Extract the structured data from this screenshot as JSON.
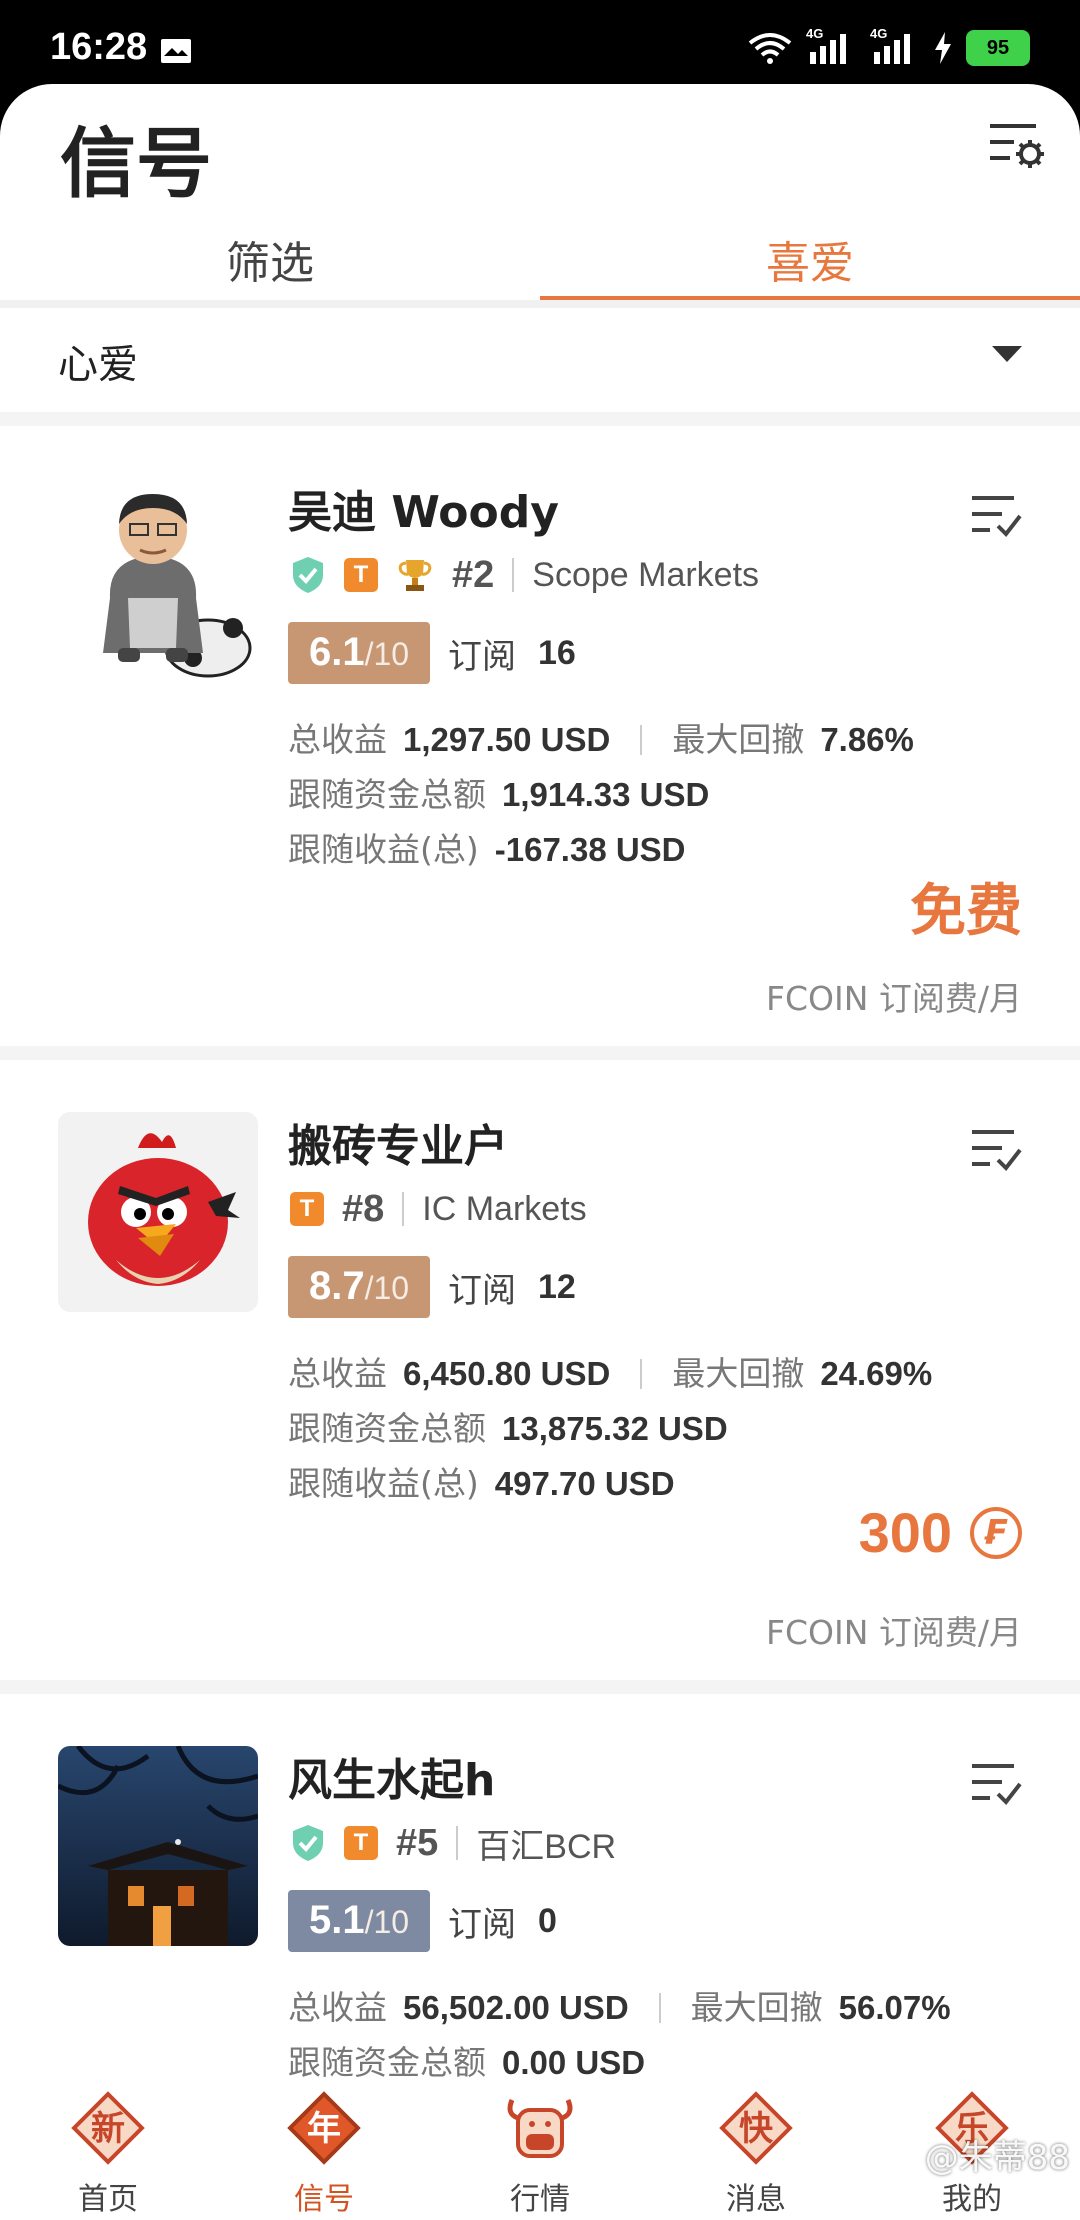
{
  "status_bar": {
    "time": "16:28",
    "battery": "95",
    "network_1": "4G",
    "network_2": "4G"
  },
  "header": {
    "title": "信号",
    "settings_icon": "filter-settings-icon"
  },
  "tabs": [
    {
      "label": "筛选",
      "active": false
    },
    {
      "label": "喜爱",
      "active": true
    }
  ],
  "dropdown": {
    "selected": "心爱"
  },
  "cards": [
    {
      "name": "吴迪 Woody",
      "verified": true,
      "t_badge": "T",
      "trophy": true,
      "rank": "#2",
      "broker": "Scope Markets",
      "score": "6.1",
      "score_den": "/10",
      "score_color": "#c79774",
      "sub_label": "订阅",
      "sub_count": "16",
      "total_profit_label": "总收益",
      "total_profit": "1,297.50 USD",
      "max_dd_label": "最大回撤",
      "max_dd": "7.86%",
      "follow_funds_label": "跟随资金总额",
      "follow_funds": "1,914.33 USD",
      "follow_profit_label": "跟随收益(总)",
      "follow_profit": "-167.38 USD",
      "price": "免费",
      "price_unit": "FCOIN 订阅费/月"
    },
    {
      "name": "搬砖专业户",
      "verified": false,
      "t_badge": "T",
      "trophy": false,
      "rank": "#8",
      "broker": "IC Markets",
      "score": "8.7",
      "score_den": "/10",
      "score_color": "#c79774",
      "sub_label": "订阅",
      "sub_count": "12",
      "total_profit_label": "总收益",
      "total_profit": "6,450.80 USD",
      "max_dd_label": "最大回撤",
      "max_dd": "24.69%",
      "follow_funds_label": "跟随资金总额",
      "follow_funds": "13,875.32 USD",
      "follow_profit_label": "跟随收益(总)",
      "follow_profit": "497.70 USD",
      "price": "300",
      "coin_symbol": "₣",
      "price_unit": "FCOIN 订阅费/月"
    },
    {
      "name": "风生水起h",
      "verified": true,
      "t_badge": "T",
      "trophy": false,
      "rank": "#5",
      "broker": "百汇BCR",
      "score": "5.1",
      "score_den": "/10",
      "score_color": "#7d8aa2",
      "sub_label": "订阅",
      "sub_count": "0",
      "total_profit_label": "总收益",
      "total_profit": "56,502.00 USD",
      "max_dd_label": "最大回撤",
      "max_dd": "56.07%",
      "follow_funds_label": "跟随资金总额",
      "follow_funds": "0.00 USD"
    }
  ],
  "bottom_nav": [
    {
      "label": "首页",
      "glyph": "新",
      "active": false
    },
    {
      "label": "信号",
      "glyph": "年",
      "active": true
    },
    {
      "label": "行情",
      "glyph": "牛",
      "active": false
    },
    {
      "label": "消息",
      "glyph": "快",
      "active": false
    },
    {
      "label": "我的",
      "glyph": "乐",
      "active": false
    }
  ],
  "watermark": "@朱蒂88",
  "accent_color": "#e8773f"
}
